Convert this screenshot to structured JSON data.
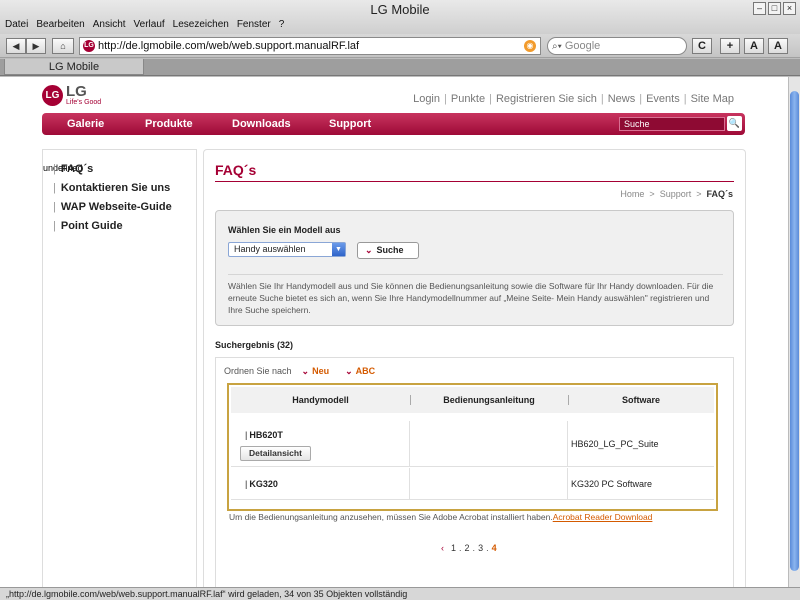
{
  "window": {
    "title": "LG Mobile",
    "menu": [
      "Datei",
      "Bearbeiten",
      "Ansicht",
      "Verlauf",
      "Lesezeichen",
      "Fenster",
      "?"
    ],
    "controls": [
      "–",
      "□",
      "×"
    ]
  },
  "toolbar": {
    "back": "◀",
    "forward": "▶",
    "home": "⌂",
    "url": "http://de.lgmobile.com/web/web.support.manualRF.laf",
    "search_placeholder": "Google",
    "reload": "C",
    "add": "+",
    "font_small": "A",
    "font_large": "A"
  },
  "tab": {
    "label": "LG Mobile"
  },
  "status": "„http://de.lgmobile.com/web/web.support.manualRF.laf“ wird geladen, 34 von 35 Objekten vollständig",
  "header": {
    "logo_mark": "LG",
    "logo_text": "LG",
    "logo_tagline": "Life's Good",
    "links": [
      "Login",
      "Punkte",
      "Registrieren Sie sich",
      "News",
      "Events",
      "Site Map"
    ],
    "link_separator": "|"
  },
  "nav": {
    "items": [
      "Galerie",
      "Produkte",
      "Downloads",
      "Support"
    ],
    "search_placeholder": "Suche",
    "search_button": "🔍"
  },
  "sidebar": {
    "undefined_text": "undefined",
    "items": [
      "FAQ´s",
      "Kontaktieren Sie uns",
      "WAP Webseite-Guide",
      "Point Guide"
    ]
  },
  "main": {
    "title": "FAQ´s",
    "breadcrumb": [
      "Home",
      "Support",
      "FAQ´s"
    ],
    "model_select": {
      "label": "Wählen Sie ein Modell aus",
      "value": "Handy auswählen",
      "button": "Suche",
      "help": "Wählen Sie Ihr Handymodell aus und Sie können die Bedienungsanleitung sowie die Software für Ihr Handy downloaden. Für die erneute Suche bietet es sich an, wenn Sie Ihre Handymodellnummer auf „Meine Seite- Mein Handy auswählen\" registrieren und Ihre Suche speichern."
    },
    "results_label": "Suchergebnis (32)",
    "sort": {
      "label": "Ordnen Sie nach",
      "options": [
        "Neu",
        "ABC"
      ]
    },
    "table": {
      "headers": [
        "Handymodell",
        "Bedienungsanleitung",
        "Software"
      ],
      "rows": [
        {
          "model": "HB620T",
          "detail_button": "Detailansicht",
          "manual": "",
          "software": "HB620_LG_PC_Suite"
        },
        {
          "model": "KG320",
          "detail_button": "",
          "manual": "",
          "software": "KG320 PC Software"
        }
      ]
    },
    "acrobat_note": "Um die Bedienungsanleitung anzusehen, müssen Sie Adobe Acrobat installiert haben.",
    "acrobat_link": "Acrobat Reader Download",
    "pagination": {
      "prev": "‹",
      "pages": [
        "1",
        "2",
        "3",
        "4"
      ],
      "current": "4"
    }
  },
  "colors": {
    "brand": "#a50034",
    "accent_orange": "#d45a00",
    "table_border": "#c8a341"
  }
}
